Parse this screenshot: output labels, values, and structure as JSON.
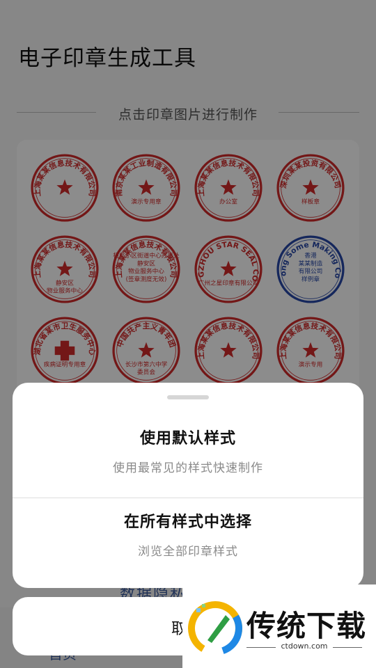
{
  "app_title": "电子印章生成工具",
  "section_label": "点击印章图片进行制作",
  "stamps": [
    {
      "name": "stamp-tech-co",
      "color": "#d22a2a",
      "ring": "上海某某信息技术有限公司",
      "center": "",
      "kind": "star"
    },
    {
      "name": "stamp-industry-demo",
      "color": "#d22a2a",
      "ring": "南京某某工业制造有限公司",
      "center": "演示专用章",
      "kind": "star"
    },
    {
      "name": "stamp-office",
      "color": "#d22a2a",
      "ring": "上海某某信息技术有限公司",
      "center": "办公室",
      "kind": "star"
    },
    {
      "name": "stamp-sample",
      "color": "#d22a2a",
      "ring": "深圳某某投资有限公司",
      "center": "样板章",
      "kind": "star"
    },
    {
      "name": "stamp-jingan",
      "color": "#d22a2a",
      "ring": "上海某某信息技术有限公司",
      "center": "静安区 物业服务中心",
      "kind": "star"
    },
    {
      "name": "stamp-property-center",
      "color": "#d22a2a",
      "ring": "上海某某信息技术有限公司",
      "center": "柯郎小区街道中心办事处 静安区 物业服务中心 (签章测度无效)",
      "kind": "text"
    },
    {
      "name": "stamp-guangzhou",
      "color": "#d22a2a",
      "ring": "GUANGZHOU STAR SEAL CO.,LTD",
      "center": "广州之星印章有限公司",
      "kind": "star"
    },
    {
      "name": "stamp-hongkong",
      "color": "#2747a8",
      "ring": "Hong Kong Some Making Company",
      "center": "香港 某某制造 有限公司 样例章",
      "kind": "text"
    },
    {
      "name": "stamp-health",
      "color": "#d22a2a",
      "ring": "湖北省某市卫生服务中心",
      "center": "疾病证明专用章",
      "kind": "cross"
    },
    {
      "name": "stamp-youth-league",
      "color": "#d22a2a",
      "ring": "中国共产主义青年团",
      "center": "长沙市第六中学 委员会",
      "kind": "star"
    },
    {
      "name": "stamp-tech-plain",
      "color": "#d22a2a",
      "ring": "上海某某信息技术有限公司",
      "center": "",
      "kind": "star"
    },
    {
      "name": "stamp-demo-use",
      "color": "#d22a2a",
      "ring": "上海某某信息技术有限公司",
      "center": "演示专用",
      "kind": "star"
    }
  ],
  "privacy_link": "数据隐私",
  "home_label": "首页",
  "sheet": {
    "option1_title": "使用默认样式",
    "option1_sub": "使用最常见的样式快速制作",
    "option2_title": "在所有样式中选择",
    "option2_sub": "浏览全部印章样式"
  },
  "cancel_label": "取消",
  "watermark": {
    "brand": "传统下载",
    "url": "ctdown.com"
  }
}
